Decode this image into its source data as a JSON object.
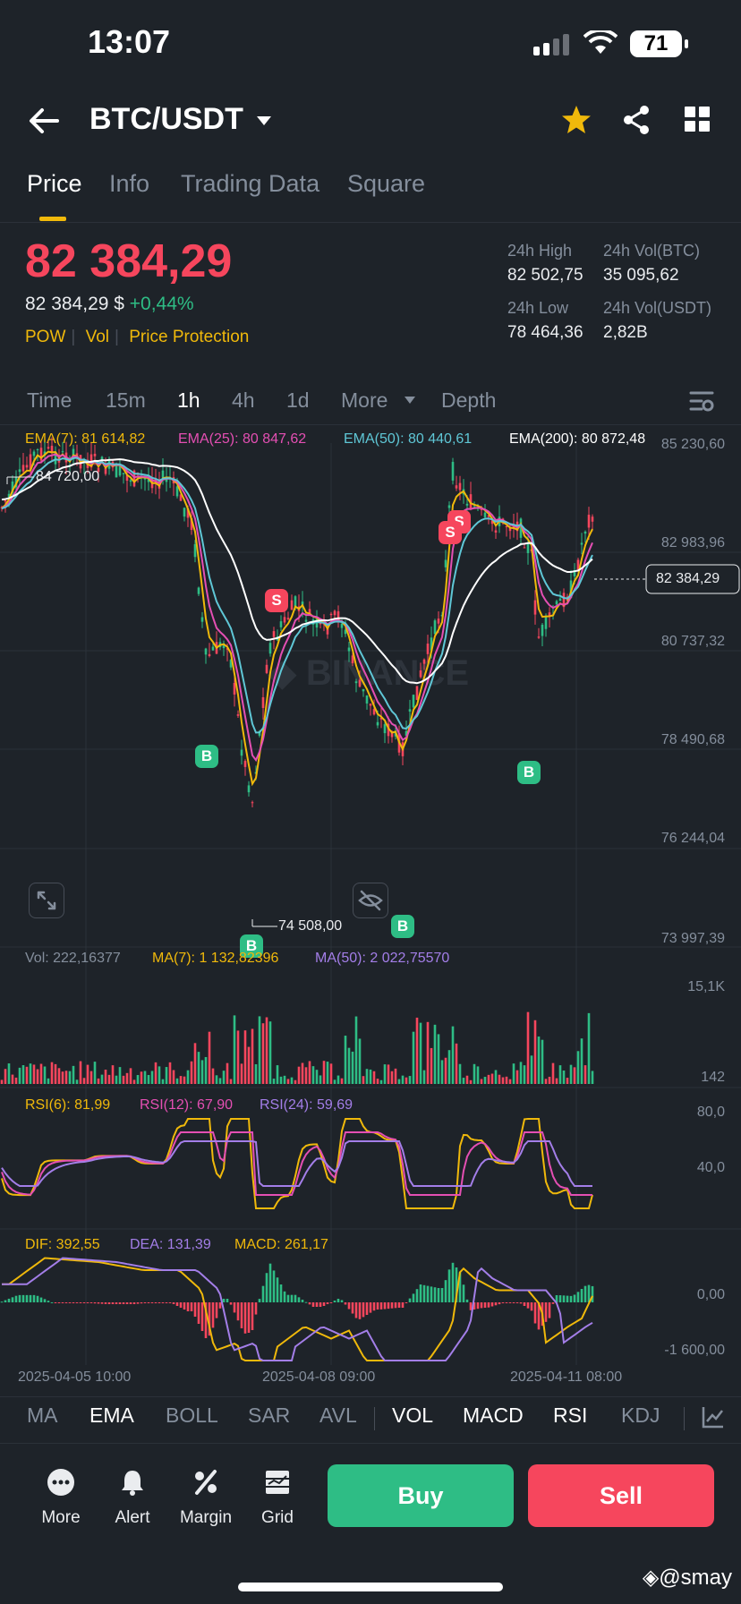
{
  "status_bar": {
    "time": "13:07",
    "battery": "71"
  },
  "header": {
    "pair": "BTC/USDT"
  },
  "tabs": [
    {
      "label": "Price"
    },
    {
      "label": "Info"
    },
    {
      "label": "Trading Data"
    },
    {
      "label": "Square"
    }
  ],
  "ticker": {
    "last_price": "82 384,29",
    "fiat_price": "82 384,29 $",
    "change_pct": "+0,44%",
    "tags": [
      "POW",
      "Vol",
      "Price Protection"
    ],
    "high_label": "24h High",
    "high_value": "82 502,75",
    "vol_btc_label": "24h Vol(BTC)",
    "vol_btc_value": "35 095,62",
    "low_label": "24h Low",
    "low_value": "78 464,36",
    "vol_usdt_label": "24h Vol(USDT)",
    "vol_usdt_value": "2,82B"
  },
  "timeframes": [
    {
      "label": "Time"
    },
    {
      "label": "15m"
    },
    {
      "label": "1h"
    },
    {
      "label": "4h"
    },
    {
      "label": "1d"
    },
    {
      "label": "More"
    },
    {
      "label": "Depth"
    }
  ],
  "ema": {
    "ema7": "EMA(7): 81 614,82",
    "ema25": "EMA(25): 80 847,62",
    "ema50": "EMA(50): 80 440,61",
    "ema200": "EMA(200): 80 872,48"
  },
  "price_axis": [
    "85 230,60",
    "82 983,96",
    "80 737,32",
    "78 490,68",
    "76 244,04",
    "73 997,39"
  ],
  "current_price_tag": "82 384,29",
  "high_marker": "84 720,00",
  "low_marker": "74 508,00",
  "trade_markers": {
    "buy": "B",
    "sell": "S"
  },
  "volume": {
    "vol": "Vol: 222,16377",
    "ma7": "MA(7): 1 132,82396",
    "ma50": "MA(50): 2 022,75570",
    "axis_top": "15,1K",
    "axis_bottom": "142"
  },
  "rsi": {
    "rsi6": "RSI(6): 81,99",
    "rsi12": "RSI(12): 67,90",
    "rsi24": "RSI(24): 59,69",
    "axis_top": "80,0",
    "axis_bottom": "40,0"
  },
  "macd": {
    "dif": "DIF: 392,55",
    "dea": "DEA: 131,39",
    "macd": "MACD: 261,17",
    "axis_top": "0,00",
    "axis_bottom": "-1 600,00"
  },
  "date_axis": [
    "2025-04-05 10:00",
    "2025-04-08 09:00",
    "2025-04-11 08:00"
  ],
  "indicators": [
    {
      "label": "MA"
    },
    {
      "label": "EMA"
    },
    {
      "label": "BOLL"
    },
    {
      "label": "SAR"
    },
    {
      "label": "AVL"
    },
    {
      "label": "VOL"
    },
    {
      "label": "MACD"
    },
    {
      "label": "RSI"
    },
    {
      "label": "KDJ"
    }
  ],
  "bottom_nav": [
    {
      "label": "More"
    },
    {
      "label": "Alert"
    },
    {
      "label": "Margin"
    },
    {
      "label": "Grid"
    }
  ],
  "buy_label": "Buy",
  "sell_label": "Sell",
  "watermark": "@smay",
  "colors": {
    "up": "#2ebd85",
    "down": "#f6465d",
    "accent": "#f0b90b",
    "ema7": "#f0b90b",
    "ema25": "#e44fb3",
    "ema50": "#5fc7d6",
    "ema200": "#ffffff",
    "rsi24": "#a37ee8"
  }
}
